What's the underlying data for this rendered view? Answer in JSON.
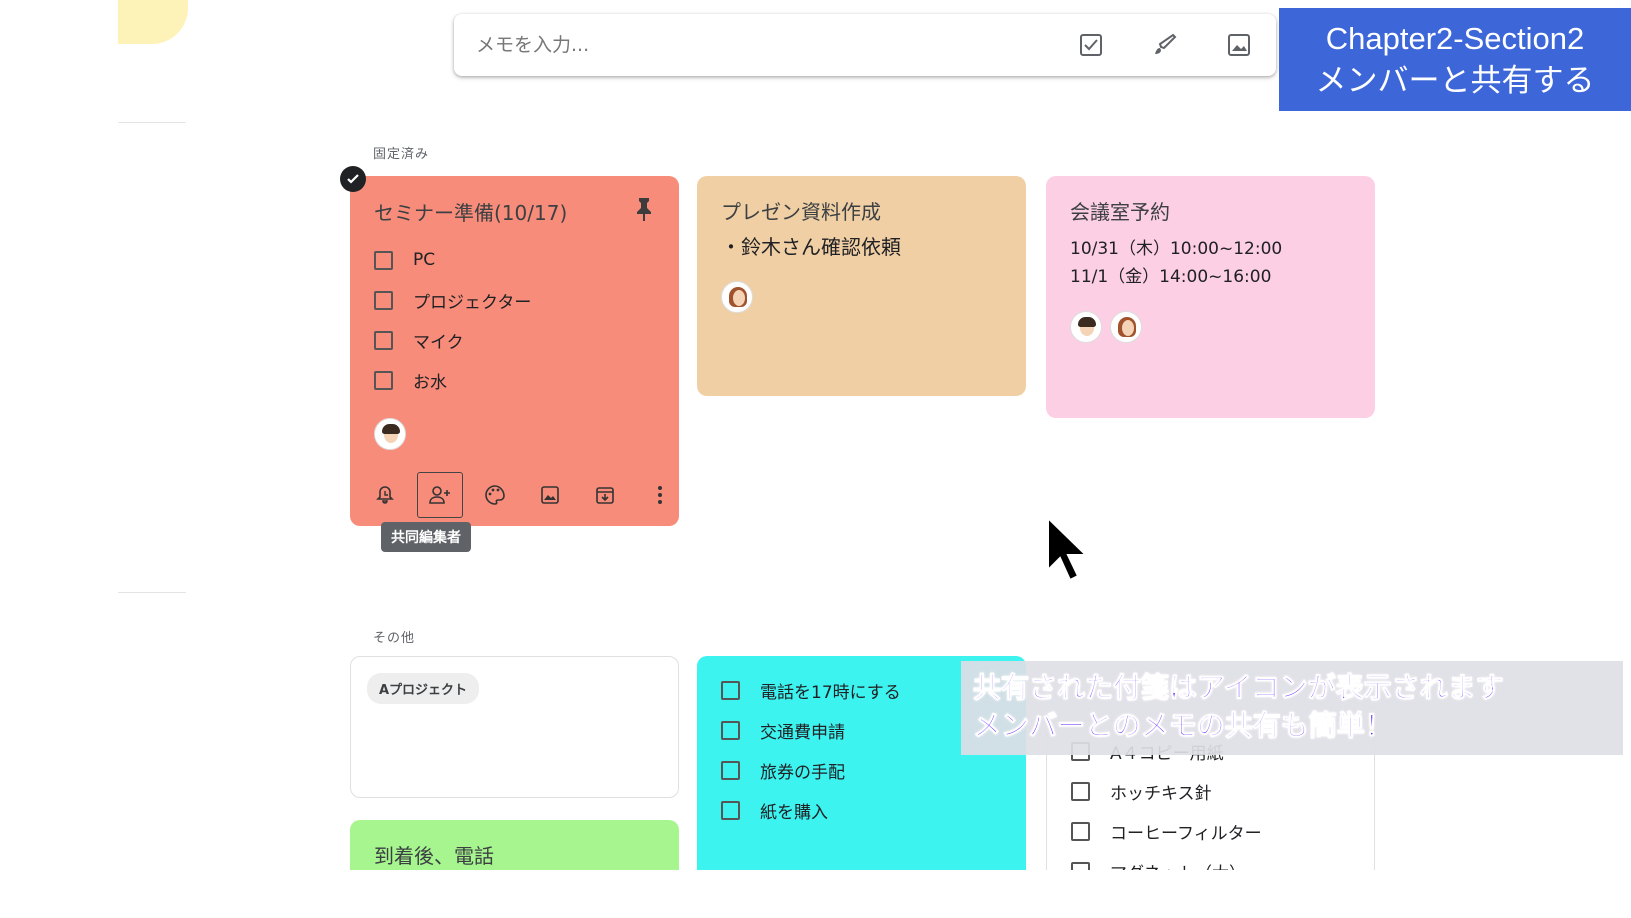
{
  "search": {
    "placeholder": "メモを入力..."
  },
  "toolbar_icons": [
    "checkbox-icon",
    "brush-icon",
    "image-icon"
  ],
  "chapter": {
    "line1": "Chapter2-Section2",
    "line2": "メンバーと共有する"
  },
  "sections": {
    "pinned": "固定済み",
    "others": "その他"
  },
  "notes": {
    "seminar": {
      "title": "セミナー準備(10/17)",
      "color": "#f88c7a",
      "items": [
        "PC",
        "プロジェクター",
        "マイク",
        "お水"
      ],
      "tooltip": "共同編集者"
    },
    "presentation": {
      "title": "プレゼン資料作成",
      "body": "・鈴木さん確認依頼",
      "color": "#f1cfa5"
    },
    "meeting": {
      "title": "会議室予約",
      "lines": [
        "10/31（木）10:00~12:00",
        "11/1（金）14:00~16:00"
      ],
      "color": "#fccfe4"
    },
    "project": {
      "chip": "Aプロジェクト"
    },
    "arrival": {
      "title": "到着後、電話",
      "color": "#a6f58e"
    },
    "tasks": {
      "color": "#3cf3f0",
      "items": [
        "電話を17時にする",
        "交通費申請",
        "旅券の手配",
        "紙を購入"
      ]
    },
    "supplies": {
      "items": [
        "A４コピー用紙",
        "ホッチキス針",
        "コーヒーフィルター",
        "マグネット（大）"
      ]
    }
  },
  "caption": {
    "line1": "共有された付箋はアイコンが表示されます",
    "line2": "メンバーとのメモの共有も簡単！"
  }
}
